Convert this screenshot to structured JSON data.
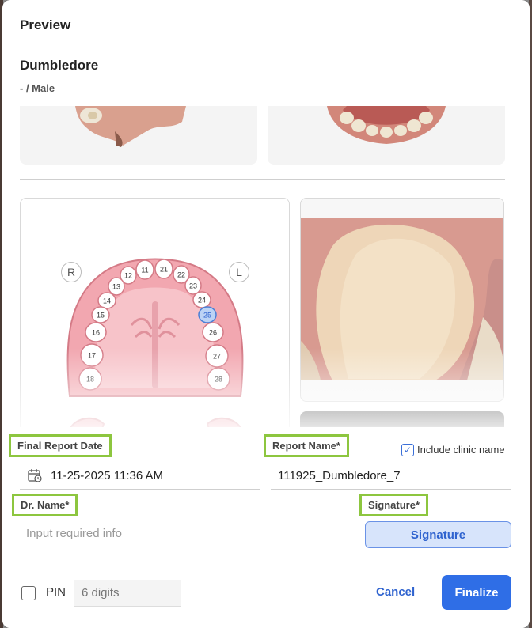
{
  "dialog": {
    "title": "Preview"
  },
  "patient": {
    "name": "Dumbledore",
    "sub": "- / Male"
  },
  "chart": {
    "right_label": "R",
    "left_label": "L",
    "teeth": [
      "11",
      "21",
      "12",
      "22",
      "13",
      "23",
      "14",
      "24",
      "15",
      "25",
      "16",
      "26",
      "17",
      "27",
      "18",
      "28"
    ],
    "selected_tooth": "25"
  },
  "form": {
    "final_report_date_label": "Final Report Date",
    "final_report_date_value": "11-25-2025 11:36 AM",
    "report_name_label": "Report Name*",
    "report_name_value": "111925_Dumbledore_7",
    "include_clinic_label": "Include clinic name",
    "dr_name_label": "Dr. Name*",
    "dr_name_placeholder": "Input required info",
    "signature_label": "Signature*",
    "signature_button": "Signature",
    "pin_label": "PIN",
    "pin_placeholder": "6 digits",
    "cancel_label": "Cancel",
    "finalize_label": "Finalize"
  },
  "colors": {
    "accent": "#2f6ee6",
    "highlight_box": "#8dc63f",
    "gum": "#f2a7b0",
    "selected_tooth": "#bcd3f5"
  }
}
